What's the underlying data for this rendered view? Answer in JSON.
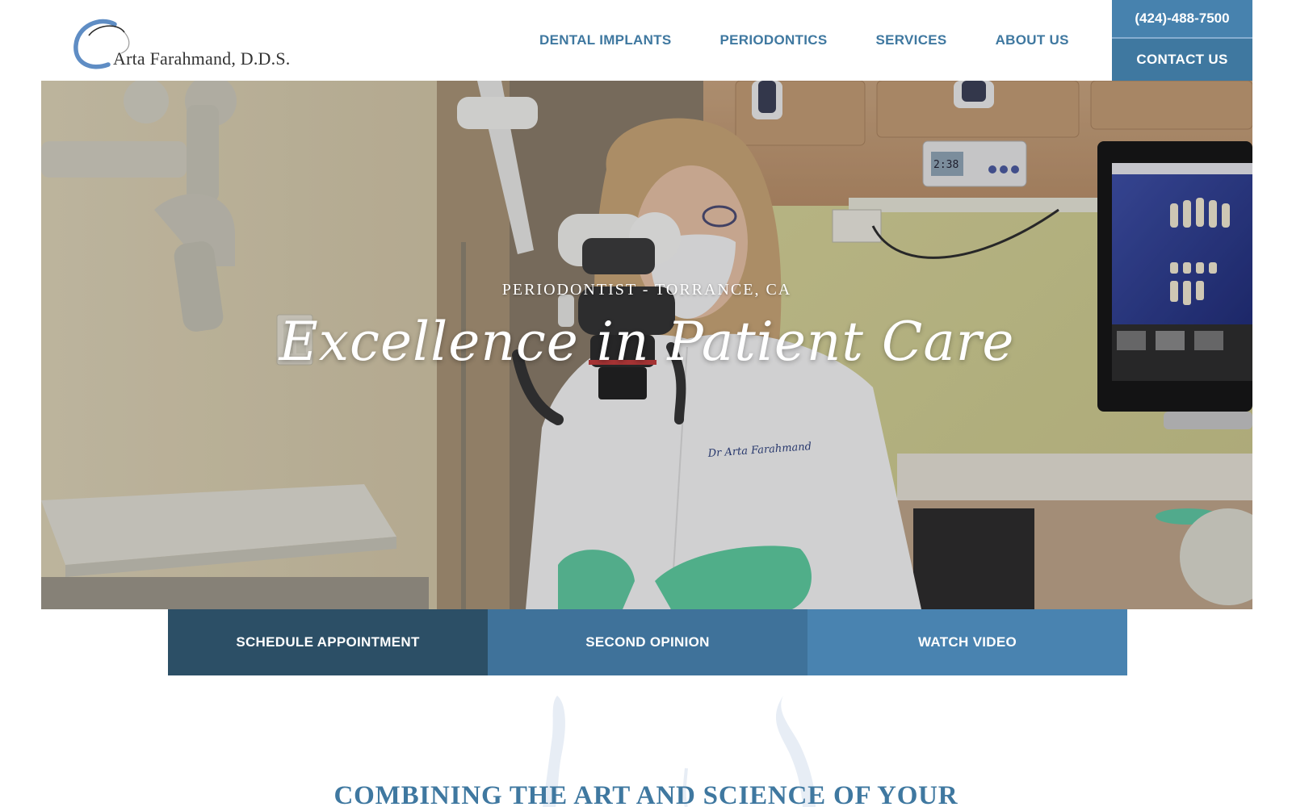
{
  "header": {
    "logo_text": "Arta Farahmand, D.D.S.",
    "nav": [
      {
        "label": "DENTAL IMPLANTS"
      },
      {
        "label": "PERIODONTICS"
      },
      {
        "label": "SERVICES"
      },
      {
        "label": "ABOUT US"
      }
    ],
    "phone": "(424)-488-7500",
    "contact_label": "CONTACT US"
  },
  "hero": {
    "subtitle": "PERIODONTIST - TORRANCE, CA",
    "title": "Excellence in Patient Care",
    "coat_name": "Dr Arta Farahmand",
    "monitor_time": "2:38"
  },
  "actions": [
    {
      "label": "SCHEDULE APPOINTMENT"
    },
    {
      "label": "SECOND OPINION"
    },
    {
      "label": "WATCH VIDEO"
    }
  ],
  "section": {
    "heading": "COMBINING THE ART AND SCIENCE OF YOUR"
  },
  "colors": {
    "brand_blue": "#3f78a0",
    "phone_blue": "#4782ae",
    "dark_navy": "#2c4f66",
    "mid_blue": "#3f729a",
    "light_blue": "#4983b0"
  },
  "icons": {
    "logo_mark": "swirl-logo-icon",
    "decor": "tooth-decor-icon"
  }
}
